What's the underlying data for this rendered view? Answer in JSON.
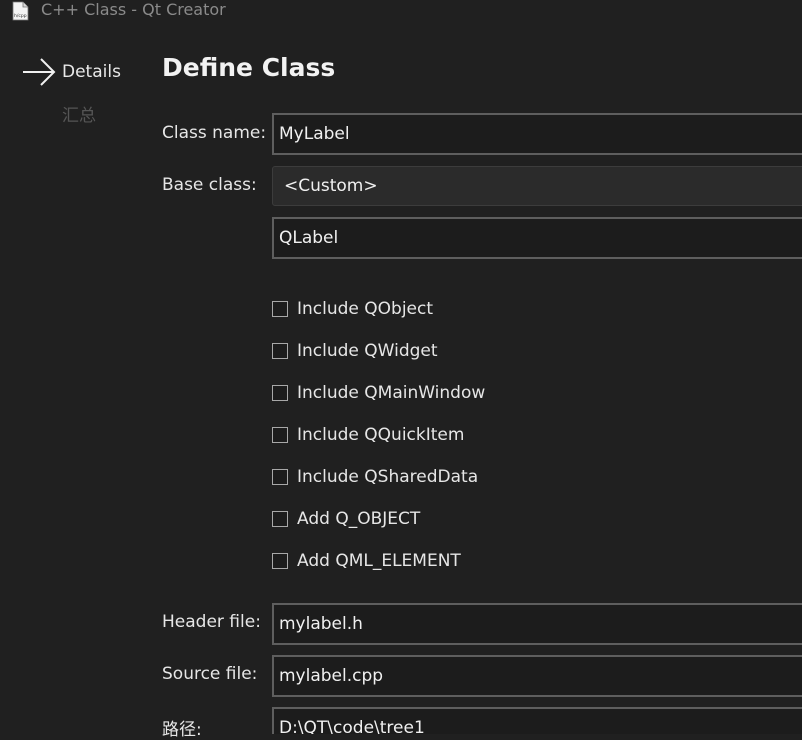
{
  "window": {
    "title": "C++ Class - Qt Creator",
    "icon": "cpp-file-icon",
    "icon_text": "h/cpp"
  },
  "steps": {
    "current": "Details",
    "next": "汇总"
  },
  "page": {
    "title": "Define Class"
  },
  "form": {
    "class_name_label": "Class name:",
    "class_name_value": "MyLabel",
    "base_class_label": "Base class:",
    "base_class_selected": "<Custom>",
    "custom_base_value": "QLabel",
    "checkboxes": [
      {
        "label": "Include QObject",
        "checked": false
      },
      {
        "label": "Include QWidget",
        "checked": false
      },
      {
        "label": "Include QMainWindow",
        "checked": false
      },
      {
        "label": "Include QQuickItem",
        "checked": false
      },
      {
        "label": "Include QSharedData",
        "checked": false
      },
      {
        "label": "Add Q_OBJECT",
        "checked": false
      },
      {
        "label": "Add QML_ELEMENT",
        "checked": false
      }
    ],
    "header_file_label": "Header file:",
    "header_file_value": "mylabel.h",
    "source_file_label": "Source file:",
    "source_file_value": "mylabel.cpp",
    "path_label": "路径:",
    "path_value": "D:\\QT\\code\\tree1"
  },
  "colors": {
    "background": "#202020",
    "field_border": "#5e5e5e"
  }
}
